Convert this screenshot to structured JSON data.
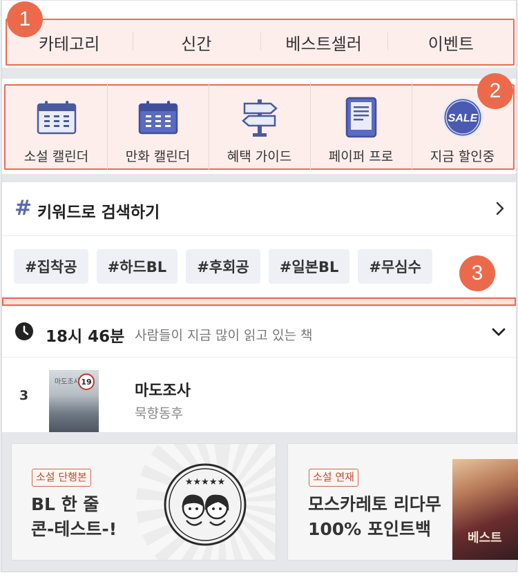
{
  "nav": {
    "items": [
      "카테고리",
      "신간",
      "베스트셀러",
      "이벤트"
    ]
  },
  "shortcuts": {
    "items": [
      {
        "label": "소설 캘린더",
        "icon": "calendar-icon"
      },
      {
        "label": "만화 캘린더",
        "icon": "calendar-icon"
      },
      {
        "label": "혜택 가이드",
        "icon": "signpost-icon"
      },
      {
        "label": "페이퍼 프로",
        "icon": "ereader-icon"
      },
      {
        "label": "지금 할인중",
        "icon": "sale-icon",
        "badge_text": "SALE"
      }
    ]
  },
  "keyword_search": {
    "hash": "#",
    "title": "키워드로 검색하기",
    "tags": [
      "#집착공",
      "#하드BL",
      "#후회공",
      "#일본BL",
      "#무심수"
    ]
  },
  "now_reading": {
    "time": "18시 46분",
    "description": "사람들이 지금 많이 읽고 있는 책",
    "book": {
      "rank": "3",
      "title": "마도조사",
      "author": "묵향동후",
      "cover_text": "마도조사",
      "age_rating": "19"
    }
  },
  "banners": [
    {
      "tag": "소설 단행본",
      "title_line1": "BL 한 줄",
      "title_line2": "콘-테스트-!",
      "stamp_stars": "★★★★★"
    },
    {
      "tag": "소설 연재",
      "title_line1": "모스카레토 리다무",
      "title_line2": "100% 포인트백",
      "cover_text": "베스트"
    }
  ],
  "annotations": [
    "1",
    "2",
    "3"
  ],
  "colors": {
    "highlight_border": "#ec6a50",
    "highlight_fill": "#fdeeec",
    "badge": "#ec6a4c",
    "icon_accent": "#5a6baa",
    "tag_bg": "#eef0f6"
  }
}
